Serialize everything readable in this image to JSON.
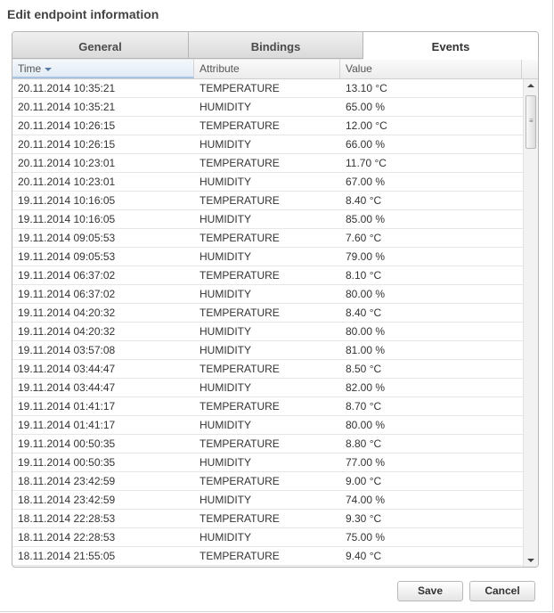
{
  "dialog": {
    "title": "Edit endpoint information"
  },
  "tabs": [
    {
      "label": "General"
    },
    {
      "label": "Bindings"
    },
    {
      "label": "Events"
    }
  ],
  "active_tab": "Events",
  "columns": {
    "time": "Time",
    "attribute": "Attribute",
    "value": "Value"
  },
  "sort": {
    "column": "Time",
    "direction": "descending"
  },
  "rows": [
    {
      "time": "20.11.2014 10:35:21",
      "attribute": "TEMPERATURE",
      "value": "13.10 °C"
    },
    {
      "time": "20.11.2014 10:35:21",
      "attribute": "HUMIDITY",
      "value": "65.00 %"
    },
    {
      "time": "20.11.2014 10:26:15",
      "attribute": "TEMPERATURE",
      "value": "12.00 °C"
    },
    {
      "time": "20.11.2014 10:26:15",
      "attribute": "HUMIDITY",
      "value": "66.00 %"
    },
    {
      "time": "20.11.2014 10:23:01",
      "attribute": "TEMPERATURE",
      "value": "11.70 °C"
    },
    {
      "time": "20.11.2014 10:23:01",
      "attribute": "HUMIDITY",
      "value": "67.00 %"
    },
    {
      "time": "19.11.2014 10:16:05",
      "attribute": "TEMPERATURE",
      "value": "8.40 °C"
    },
    {
      "time": "19.11.2014 10:16:05",
      "attribute": "HUMIDITY",
      "value": "85.00 %"
    },
    {
      "time": "19.11.2014 09:05:53",
      "attribute": "TEMPERATURE",
      "value": "7.60 °C"
    },
    {
      "time": "19.11.2014 09:05:53",
      "attribute": "HUMIDITY",
      "value": "79.00 %"
    },
    {
      "time": "19.11.2014 06:37:02",
      "attribute": "TEMPERATURE",
      "value": "8.10 °C"
    },
    {
      "time": "19.11.2014 06:37:02",
      "attribute": "HUMIDITY",
      "value": "80.00 %"
    },
    {
      "time": "19.11.2014 04:20:32",
      "attribute": "TEMPERATURE",
      "value": "8.40 °C"
    },
    {
      "time": "19.11.2014 04:20:32",
      "attribute": "HUMIDITY",
      "value": "80.00 %"
    },
    {
      "time": "19.11.2014 03:57:08",
      "attribute": "HUMIDITY",
      "value": "81.00 %"
    },
    {
      "time": "19.11.2014 03:44:47",
      "attribute": "TEMPERATURE",
      "value": "8.50 °C"
    },
    {
      "time": "19.11.2014 03:44:47",
      "attribute": "HUMIDITY",
      "value": "82.00 %"
    },
    {
      "time": "19.11.2014 01:41:17",
      "attribute": "TEMPERATURE",
      "value": "8.70 °C"
    },
    {
      "time": "19.11.2014 01:41:17",
      "attribute": "HUMIDITY",
      "value": "80.00 %"
    },
    {
      "time": "19.11.2014 00:50:35",
      "attribute": "TEMPERATURE",
      "value": "8.80 °C"
    },
    {
      "time": "19.11.2014 00:50:35",
      "attribute": "HUMIDITY",
      "value": "77.00 %"
    },
    {
      "time": "18.11.2014 23:42:59",
      "attribute": "TEMPERATURE",
      "value": "9.00 °C"
    },
    {
      "time": "18.11.2014 23:42:59",
      "attribute": "HUMIDITY",
      "value": "74.00 %"
    },
    {
      "time": "18.11.2014 22:28:53",
      "attribute": "TEMPERATURE",
      "value": "9.30 °C"
    },
    {
      "time": "18.11.2014 22:28:53",
      "attribute": "HUMIDITY",
      "value": "75.00 %"
    },
    {
      "time": "18.11.2014 21:55:05",
      "attribute": "TEMPERATURE",
      "value": "9.40 °C"
    }
  ],
  "buttons": {
    "save": "Save",
    "cancel": "Cancel"
  }
}
